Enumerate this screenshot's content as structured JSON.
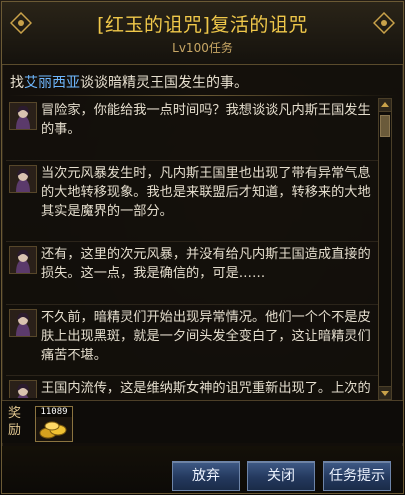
{
  "header": {
    "title": "[红玉的诅咒]复活的诅咒",
    "subtitle": "Lv100任务"
  },
  "goal": {
    "prefix": "找",
    "npc": "艾丽西亚",
    "suffix": "谈谈暗精灵王国发生的事。"
  },
  "messages": [
    {
      "text": "冒险家，你能给我一点时间吗？我想谈谈凡内斯王国发生的事。"
    },
    {
      "text": "当次元风暴发生时，凡内斯王国里也出现了带有异常气息的大地转移现象。我也是来联盟后才知道，转移来的大地其实是魔界的一部分。"
    },
    {
      "text": "还有，这里的次元风暴，并没有给凡内斯王国造成直接的损失。这一点，我是确信的，可是……"
    },
    {
      "text": "不久前，暗精灵们开始出现异常情况。他们一个个不是皮肤上出现黑斑，就是一夕间头发全变白了，这让暗精灵们痛苦不堪。"
    },
    {
      "text": "王国内流传，这是维纳斯女神的诅咒重新出现了。上次的传染病已经让王国失去了很多百姓，梅娅女王"
    }
  ],
  "reward": {
    "label": "奖励",
    "item_count": "11089"
  },
  "buttons": {
    "abandon": "放弃",
    "close": "关闭",
    "hint": "任务提示"
  },
  "colors": {
    "title": "#f0c84a",
    "npc_highlight": "#6fb8ff",
    "button": "#2e4770"
  }
}
